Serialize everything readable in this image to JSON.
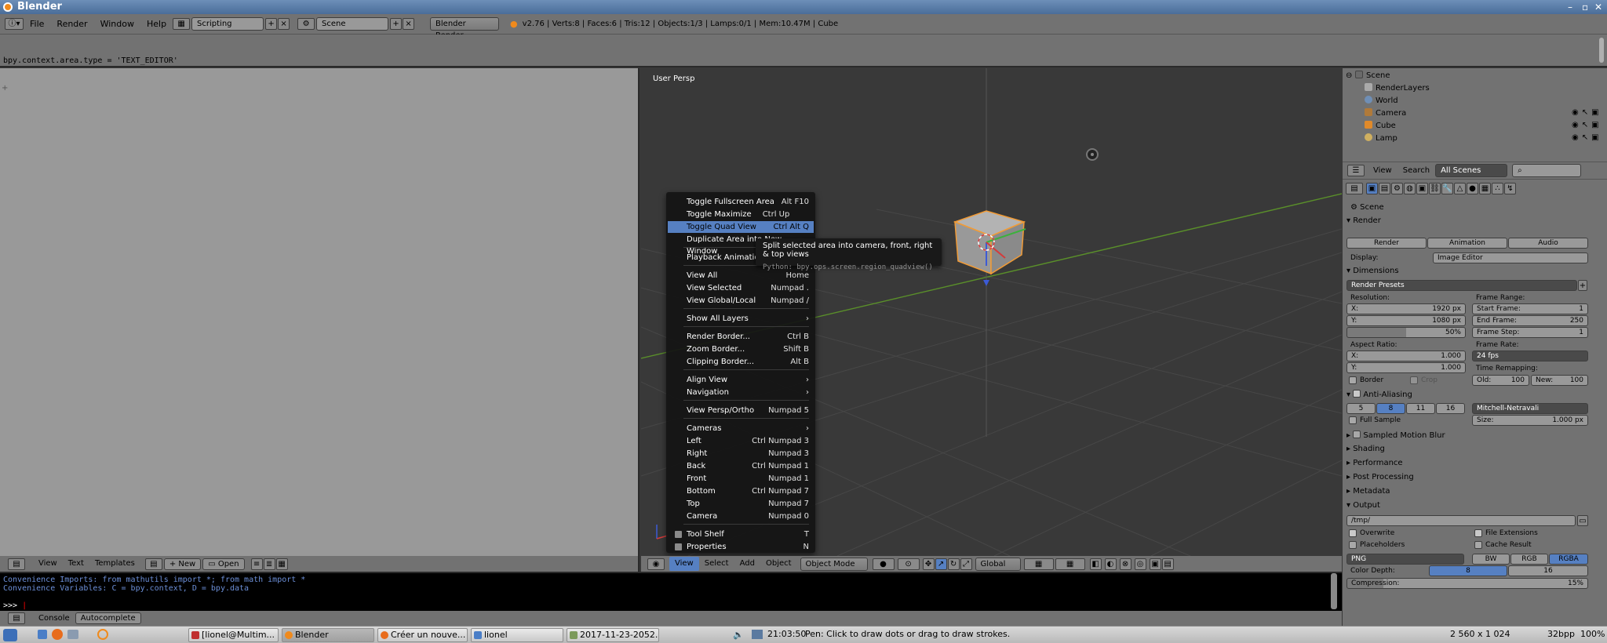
{
  "window": {
    "title": "Blender"
  },
  "info": {
    "menus": [
      "File",
      "Render",
      "Window",
      "Help"
    ],
    "screen_layout": "Scripting",
    "scene": "Scene",
    "engine": "Blender Render",
    "stats": "v2.76 | Verts:8 | Faces:6 | Tris:12 | Objects:1/3 | Lamps:0/1 | Mem:10.47M | Cube"
  },
  "report": {
    "line": "bpy.context.area.type = 'TEXT_EDITOR'"
  },
  "text_editor": {
    "menus": [
      "View",
      "Text",
      "Templates"
    ],
    "new_label": "New",
    "open_label": "Open"
  },
  "viewport": {
    "label": "User Persp",
    "menus": [
      "View",
      "Select",
      "Add",
      "Object"
    ],
    "mode": "Object Mode",
    "orientation": "Global"
  },
  "view_menu": {
    "items": [
      {
        "label": "Toggle Fullscreen Area",
        "shortcut": "Alt F10"
      },
      {
        "label": "Toggle Maximize Area",
        "shortcut": "Ctrl Up Arrow"
      },
      {
        "label": "Toggle Quad View",
        "shortcut": "Ctrl Alt Q"
      },
      {
        "label": "Duplicate Area into New Window",
        "shortcut": ""
      },
      {
        "label": "Playback Animation",
        "shortcut": ""
      },
      {
        "label": "View All",
        "shortcut": "Home"
      },
      {
        "label": "View Selected",
        "shortcut": "Numpad ."
      },
      {
        "label": "View Global/Local",
        "shortcut": "Numpad /"
      },
      {
        "label": "Show All Layers",
        "shortcut": ""
      },
      {
        "label": "Render Border...",
        "shortcut": "Ctrl B"
      },
      {
        "label": "Zoom Border...",
        "shortcut": "Shift B"
      },
      {
        "label": "Clipping Border...",
        "shortcut": "Alt B"
      },
      {
        "label": "Align View",
        "shortcut": "›"
      },
      {
        "label": "Navigation",
        "shortcut": "›"
      },
      {
        "label": "View Persp/Ortho",
        "shortcut": "Numpad 5"
      },
      {
        "label": "Cameras",
        "shortcut": "›"
      },
      {
        "label": "Left",
        "shortcut": "Ctrl Numpad 3"
      },
      {
        "label": "Right",
        "shortcut": "Numpad 3"
      },
      {
        "label": "Back",
        "shortcut": "Ctrl Numpad 1"
      },
      {
        "label": "Front",
        "shortcut": "Numpad 1"
      },
      {
        "label": "Bottom",
        "shortcut": "Ctrl Numpad 7"
      },
      {
        "label": "Top",
        "shortcut": "Numpad 7"
      },
      {
        "label": "Camera",
        "shortcut": "Numpad 0"
      },
      {
        "label": "Tool Shelf",
        "shortcut": "T"
      },
      {
        "label": "Properties",
        "shortcut": "N"
      }
    ],
    "highlighted": "Toggle Quad View"
  },
  "tooltip": {
    "text": "Split selected area into camera, front, right & top views",
    "python": "Python: bpy.ops.screen.region_quadview()"
  },
  "outliner": {
    "items": [
      "Scene",
      "RenderLayers",
      "World",
      "Camera",
      "Cube",
      "Lamp"
    ],
    "header_menus": [
      "View",
      "Search"
    ],
    "filter": "All Scenes"
  },
  "properties": {
    "context": "Scene",
    "render_panel": "Render",
    "render_buttons": [
      "Render",
      "Animation",
      "Audio"
    ],
    "display_label": "Display:",
    "display_value": "Image Editor",
    "dimensions_panel": "Dimensions",
    "presets": "Render Presets",
    "resolution_label": "Resolution:",
    "res_x": "1920 px",
    "res_y": "1080 px",
    "res_pct": "50%",
    "frame_range_label": "Frame Range:",
    "start_frame": "1",
    "end_frame": "250",
    "frame_step": "1",
    "start_frame_label": "Start Frame:",
    "end_frame_label": "End Frame:",
    "frame_step_label": "Frame Step:",
    "aspect_label": "Aspect Ratio:",
    "aspect_x": "1.000",
    "aspect_y": "1.000",
    "frame_rate_label": "Frame Rate:",
    "frame_rate": "24 fps",
    "time_remap_label": "Time Remapping:",
    "old": "100",
    "new": "100",
    "old_label": "Old:",
    "new_label": "New:",
    "x_label": "X:",
    "y_label": "Y:",
    "border_label": "Border",
    "crop_label": "Crop",
    "aa_panel": "Anti-Aliasing",
    "aa_samples": [
      "5",
      "8",
      "11",
      "16"
    ],
    "aa_filter": "Mitchell-Netravali",
    "full_sample": "Full Sample",
    "size_label": "Size:",
    "size_value": "1.000 px",
    "closed_panels": [
      "Sampled Motion Blur",
      "Shading",
      "Performance",
      "Post Processing",
      "Metadata"
    ],
    "output_panel": "Output",
    "output_path": "/tmp/",
    "overwrite": "Overwrite",
    "file_ext": "File Extensions",
    "placeholders": "Placeholders",
    "cache_result": "Cache Result",
    "format": "PNG",
    "color_modes": [
      "BW",
      "RGB",
      "RGBA"
    ],
    "color_depth_label": "Color Depth:",
    "depths": [
      "8",
      "16"
    ],
    "compression_label": "Compression:",
    "compression": "15%"
  },
  "console": {
    "line1": "Convenience Imports: from mathutils import *; from math import *",
    "line2": "Convenience Variables: C = bpy.context, D = bpy.data",
    "prompt": ">>> ",
    "buttons": [
      "Console",
      "Autocomplete"
    ]
  },
  "taskbar": {
    "tasks": [
      "[lionel@Multim...",
      "Blender",
      "Créer un nouve...",
      "lionel",
      "2017-11-23-2052..."
    ],
    "clock": "21:03:50",
    "status": "Pen: Click to draw dots or drag to draw strokes.",
    "resolution": "2 560 x 1 024",
    "bpp": "32bpp",
    "zoom": "100%"
  }
}
